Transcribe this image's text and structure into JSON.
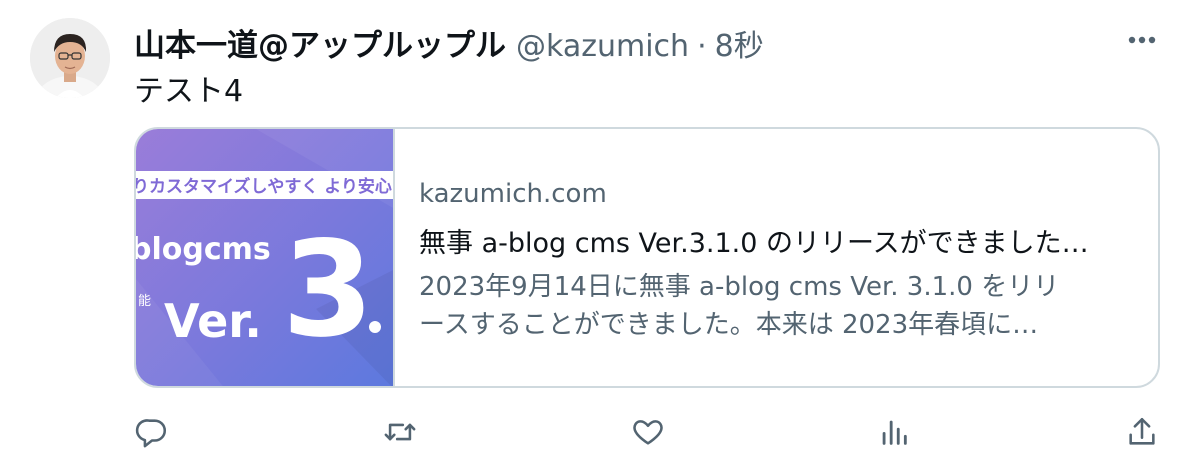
{
  "tweet": {
    "display_name": "山本一道@アップルップル",
    "handle": "@kazumich",
    "separator": "·",
    "time": "8秒",
    "text": "テスト4",
    "more_icon": "more-horizontal-icon"
  },
  "card": {
    "thumbnail": {
      "tagline": "りカスタマイズしやすく より安心",
      "logo_text": "blogcms",
      "version_prefix": "Ver.",
      "version_number": "3",
      "side_text": "能",
      "gradient_colors": [
        "#8f79d6",
        "#5d78dd"
      ]
    },
    "domain": "kazumich.com",
    "title": "無事 a-blog cms Ver.3.1.0 のリリースができました…",
    "description_lines": [
      "2023年9月14日に無事 a-blog cms Ver. 3.1.0 をリリ",
      "ースすることができました。本来は 2023年春頃に…"
    ]
  },
  "actions": [
    {
      "name": "reply",
      "icon": "reply-icon"
    },
    {
      "name": "retweet",
      "icon": "retweet-icon"
    },
    {
      "name": "like",
      "icon": "heart-icon"
    },
    {
      "name": "views",
      "icon": "analytics-icon"
    },
    {
      "name": "share",
      "icon": "share-icon"
    }
  ],
  "colors": {
    "text_primary": "#0f1419",
    "text_secondary": "#536471",
    "border": "#cfd9de"
  }
}
